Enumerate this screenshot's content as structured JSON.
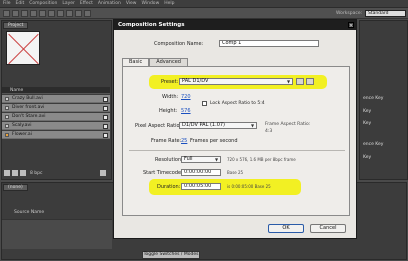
{
  "menu": [
    "File",
    "Edit",
    "Composition",
    "Layer",
    "Effect",
    "Animation",
    "View",
    "Window",
    "Help"
  ],
  "workspace": {
    "label": "Workspace:",
    "value": "Standard"
  },
  "project_tab": "Project",
  "list_header": "Name",
  "files": [
    "Crazy Bull.avi",
    "Diver front.avi",
    "Don't Stare.avi",
    "Scaly.avi",
    "Flower.ai"
  ],
  "bit_depth": "8 bpc",
  "right_panel": {
    "items": [
      "ence Key",
      "Key",
      "Key",
      "ence Key",
      "Key"
    ]
  },
  "timeline": {
    "tab": "(none)",
    "source_header": "Source Name",
    "toggle_label": "Toggle Switches / Modes"
  },
  "dialog": {
    "title": "Composition Settings",
    "comp_name_label": "Composition Name:",
    "comp_name_value": "Comp 1",
    "tabs": [
      "Basic",
      "Advanced"
    ],
    "preset_label": "Preset:",
    "preset_value": "PAL D1/DV",
    "width_label": "Width:",
    "width_value": "720",
    "height_label": "Height:",
    "height_value": "576",
    "lock_label": "Lock Aspect Ratio to 5:4",
    "par_label": "Pixel Aspect Ratio:",
    "par_value": "D1/DV PAL (1.07)",
    "frame_ar_label": "Frame Aspect Ratio:",
    "frame_ar_value": "4:3",
    "frame_rate_label": "Frame Rate:",
    "frame_rate_value": "25",
    "frame_rate_unit": "Frames per second",
    "resolution_label": "Resolution:",
    "resolution_value": "Full",
    "resolution_note": "720 x 576, 1.6 MB per 8bpc frame",
    "start_tc_label": "Start Timecode:",
    "start_tc_value": "0:00:00:00",
    "start_tc_note": "Base 25",
    "duration_label": "Duration:",
    "duration_value": "0:00:05:00",
    "duration_note": "is 0:00:05:00 Base 25",
    "ok_label": "OK",
    "cancel_label": "Cancel"
  },
  "colors": {
    "highlight": "#f2f000",
    "link": "#1a4fc0",
    "dialog_bg": "#e9e7e3"
  }
}
